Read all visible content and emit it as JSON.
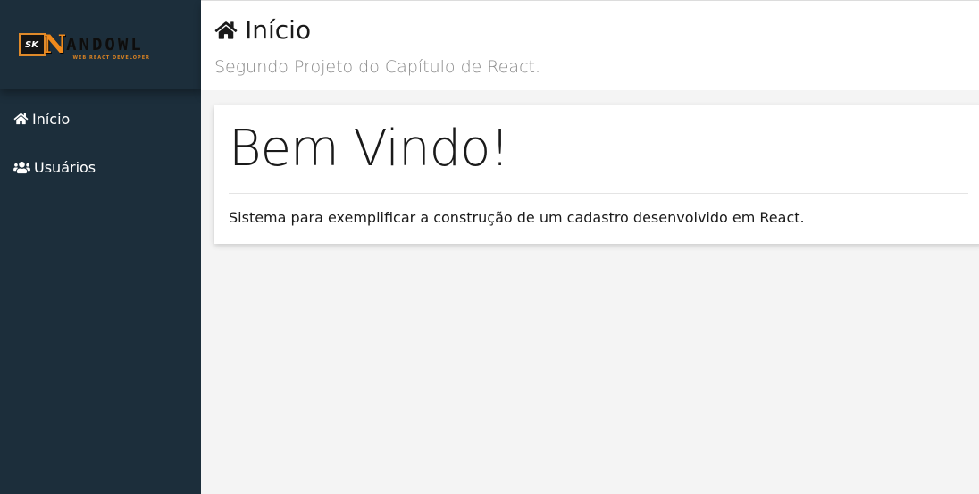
{
  "sidebar": {
    "logo": {
      "badge": "SK",
      "initial": "N",
      "text": "ANDOWL",
      "tagline": "WEB REACT DEVELOPER"
    },
    "items": [
      {
        "label": "Início",
        "icon": "home-icon"
      },
      {
        "label": "Usuários",
        "icon": "users-icon"
      }
    ]
  },
  "header": {
    "title": "Início",
    "title_icon": "home-icon",
    "subtitle": "Segundo Projeto do Capítulo de React."
  },
  "main": {
    "heading": "Bem Vindo!",
    "description": "Sistema para exemplificar a construção de um cadastro desenvolvido em React."
  },
  "colors": {
    "sidebar_bg": "#1c2e3b",
    "content_bg": "#f4f4f4",
    "logo_accent": "#f08a1c"
  }
}
